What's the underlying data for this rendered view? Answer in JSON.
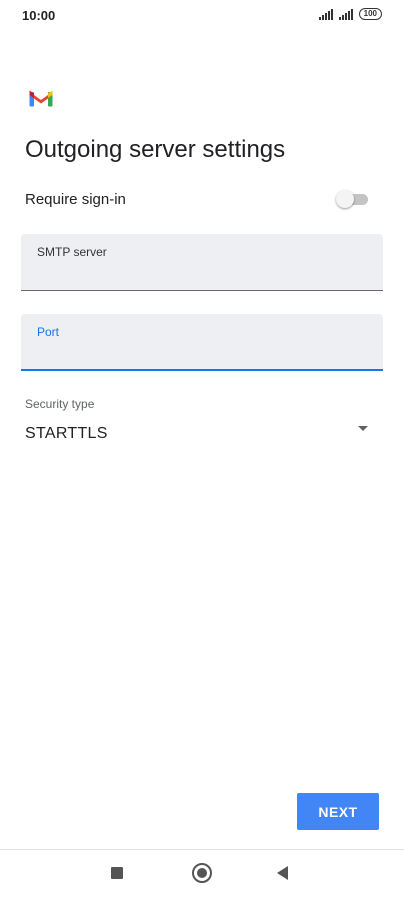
{
  "status_bar": {
    "time": "10:00",
    "battery": "100"
  },
  "app": {
    "logo_icon": "gmail-logo-icon"
  },
  "page": {
    "title": "Outgoing server settings"
  },
  "require_signin": {
    "label": "Require sign-in",
    "enabled": false
  },
  "smtp_server": {
    "label": "SMTP server",
    "value": ""
  },
  "port": {
    "label": "Port",
    "value": ""
  },
  "security": {
    "label": "Security type",
    "value": "STARTTLS"
  },
  "actions": {
    "next_label": "NEXT"
  },
  "colors": {
    "accent": "#1a73e8",
    "button": "#4285f4",
    "field_bg": "#eeeff2"
  },
  "nav": {
    "icons": [
      "recent-apps-icon",
      "home-icon",
      "back-icon"
    ]
  }
}
